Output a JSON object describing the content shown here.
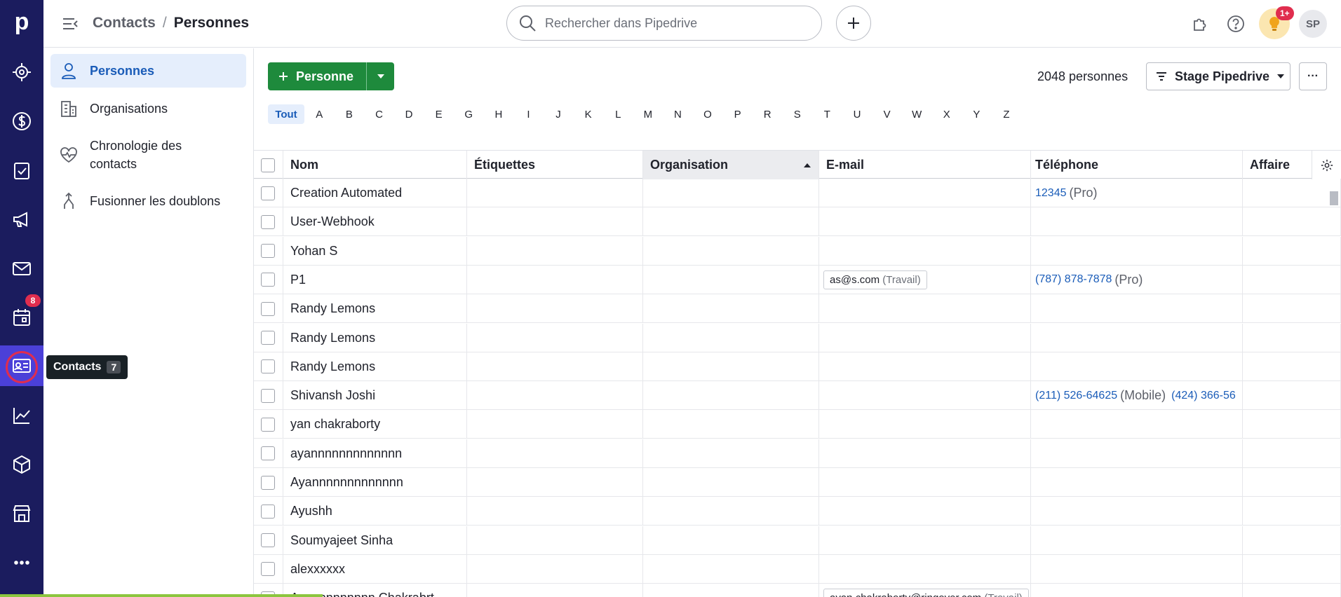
{
  "rail": {
    "logo": "p",
    "items": [
      {
        "name": "leads-icon"
      },
      {
        "name": "deals-icon"
      },
      {
        "name": "activities-icon"
      },
      {
        "name": "campaigns-icon"
      },
      {
        "name": "mail-icon"
      },
      {
        "name": "calendar-icon",
        "badge": "8"
      },
      {
        "name": "contacts-icon",
        "active": true
      },
      {
        "name": "insights-icon"
      },
      {
        "name": "products-icon"
      },
      {
        "name": "marketplace-icon"
      },
      {
        "name": "more-icon"
      }
    ],
    "tooltip": {
      "label": "Contacts",
      "shortcut": "7"
    }
  },
  "topbar": {
    "breadcrumb_parent": "Contacts",
    "breadcrumb_sep": "/",
    "breadcrumb_current": "Personnes",
    "search_placeholder": "Rechercher dans Pipedrive",
    "bulb_badge": "1+",
    "avatar": "SP"
  },
  "sidebar": {
    "items": [
      {
        "label": "Personnes",
        "icon": "person-icon"
      },
      {
        "label": "Organisations",
        "icon": "building-icon"
      },
      {
        "label": "Chronologie des contacts",
        "icon": "heart-pulse-icon"
      },
      {
        "label": "Fusionner les doublons",
        "icon": "merge-icon"
      }
    ]
  },
  "toolbar": {
    "add_label": "Personne",
    "count": "2048 personnes",
    "filter_label": "Stage Pipedrive",
    "more": "···",
    "alphabet": [
      "Tout",
      "A",
      "B",
      "C",
      "D",
      "E",
      "G",
      "H",
      "I",
      "J",
      "K",
      "L",
      "M",
      "N",
      "O",
      "P",
      "R",
      "S",
      "T",
      "U",
      "V",
      "W",
      "X",
      "Y",
      "Z"
    ]
  },
  "table": {
    "columns": [
      "Nom",
      "Étiquettes",
      "Organisation",
      "E-mail",
      "Téléphone",
      "Affaire"
    ],
    "rows": [
      {
        "name": "Creation Automated",
        "email": "",
        "email_type": "",
        "phone": "12345",
        "phone_type": "(Pro)",
        "phone2": ""
      },
      {
        "name": "User-Webhook",
        "email": "",
        "email_type": "",
        "phone": "",
        "phone_type": "",
        "phone2": ""
      },
      {
        "name": "Yohan S",
        "email": "",
        "email_type": "",
        "phone": "",
        "phone_type": "",
        "phone2": ""
      },
      {
        "name": "P1",
        "email": "as@s.com",
        "email_type": "(Travail)",
        "phone": "(787) 878-7878",
        "phone_type": "(Pro)",
        "phone2": ""
      },
      {
        "name": "Randy Lemons",
        "email": "",
        "email_type": "",
        "phone": "",
        "phone_type": "",
        "phone2": ""
      },
      {
        "name": "Randy Lemons",
        "email": "",
        "email_type": "",
        "phone": "",
        "phone_type": "",
        "phone2": ""
      },
      {
        "name": "Randy Lemons",
        "email": "",
        "email_type": "",
        "phone": "",
        "phone_type": "",
        "phone2": ""
      },
      {
        "name": "Shivansh Joshi",
        "email": "",
        "email_type": "",
        "phone": "(211) 526-64625",
        "phone_type": "(Mobile)",
        "phone2": "(424) 366-56"
      },
      {
        "name": "yan chakraborty",
        "email": "",
        "email_type": "",
        "phone": "",
        "phone_type": "",
        "phone2": ""
      },
      {
        "name": "ayannnnnnnnnnnnn",
        "email": "",
        "email_type": "",
        "phone": "",
        "phone_type": "",
        "phone2": ""
      },
      {
        "name": "Ayannnnnnnnnnnnn",
        "email": "",
        "email_type": "",
        "phone": "",
        "phone_type": "",
        "phone2": ""
      },
      {
        "name": "Ayushh",
        "email": "",
        "email_type": "",
        "phone": "",
        "phone_type": "",
        "phone2": ""
      },
      {
        "name": "Soumyajeet Sinha",
        "email": "",
        "email_type": "",
        "phone": "",
        "phone_type": "",
        "phone2": ""
      },
      {
        "name": "alexxxxxx",
        "email": "",
        "email_type": "",
        "phone": "",
        "phone_type": "",
        "phone2": ""
      },
      {
        "name": "Ayannnnnnnnn Chakrabrt",
        "email": "ayan.chakraborty@ringover.com",
        "email_type": "(Travail)",
        "phone": "",
        "phone_type": "",
        "phone2": ""
      }
    ]
  }
}
